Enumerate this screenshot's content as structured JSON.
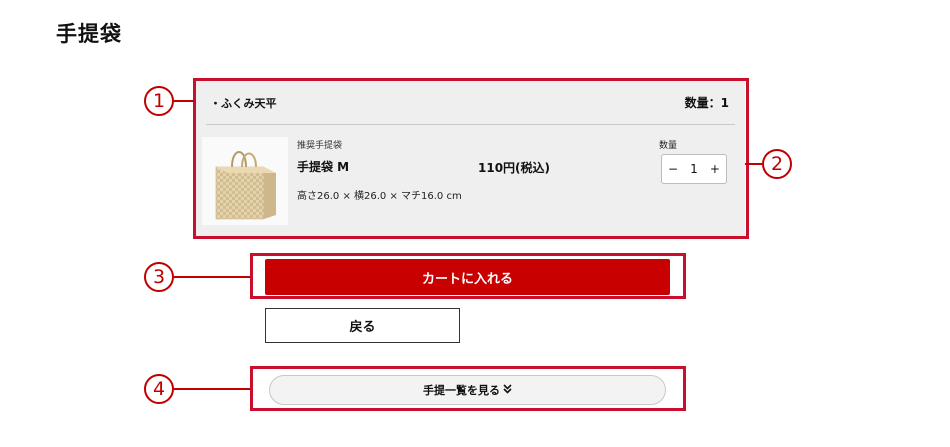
{
  "page": {
    "title": "手提袋"
  },
  "panel": {
    "store_name": "・ふくみ天平",
    "total_qty": "数量：1",
    "item": {
      "category": "推奨手提袋",
      "name": "手提袋 M",
      "price": "110円(税込)",
      "dimensions": "高さ26.0 × 横26.0 × マチ16.0 cm",
      "qty_label": "数量",
      "qty_value": "1",
      "minus": "−",
      "plus": "+"
    }
  },
  "buttons": {
    "add_to_cart": "カートに入れる",
    "back": "戻る",
    "show_list": "手提一覧を見る"
  },
  "callouts": [
    "1",
    "2",
    "3",
    "4"
  ],
  "colors": {
    "accent": "#c90000",
    "annotation": "#c8102e",
    "panel_bg": "#efefef"
  }
}
